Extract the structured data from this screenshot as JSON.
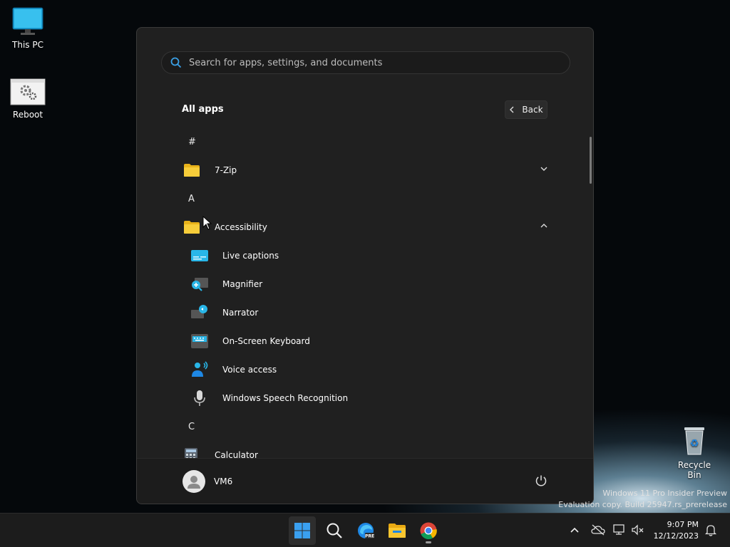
{
  "desktop": {
    "this_pc": "This PC",
    "reboot": "Reboot",
    "recycle_bin": "Recycle Bin"
  },
  "start_menu": {
    "search_placeholder": "Search for apps, settings, and documents",
    "title": "All apps",
    "back_label": "Back",
    "sections": {
      "hash": "#",
      "a": "A",
      "c": "C"
    },
    "apps": {
      "seven_zip": "7-Zip",
      "accessibility": "Accessibility",
      "live_captions": "Live captions",
      "magnifier": "Magnifier",
      "narrator": "Narrator",
      "on_screen_keyboard": "On-Screen Keyboard",
      "voice_access": "Voice access",
      "speech_recognition": "Windows Speech Recognition",
      "calculator": "Calculator"
    },
    "user": "VM6"
  },
  "watermark": {
    "line1": "Windows 11 Pro Insider Preview",
    "line2": "Evaluation copy. Build 25947.rs_prerelease"
  },
  "clock": {
    "time": "9:07 PM",
    "date": "12/12/2023"
  },
  "colors": {
    "accent": "#0078d4",
    "folder": "#f5c518",
    "menu_bg": "#202020"
  }
}
